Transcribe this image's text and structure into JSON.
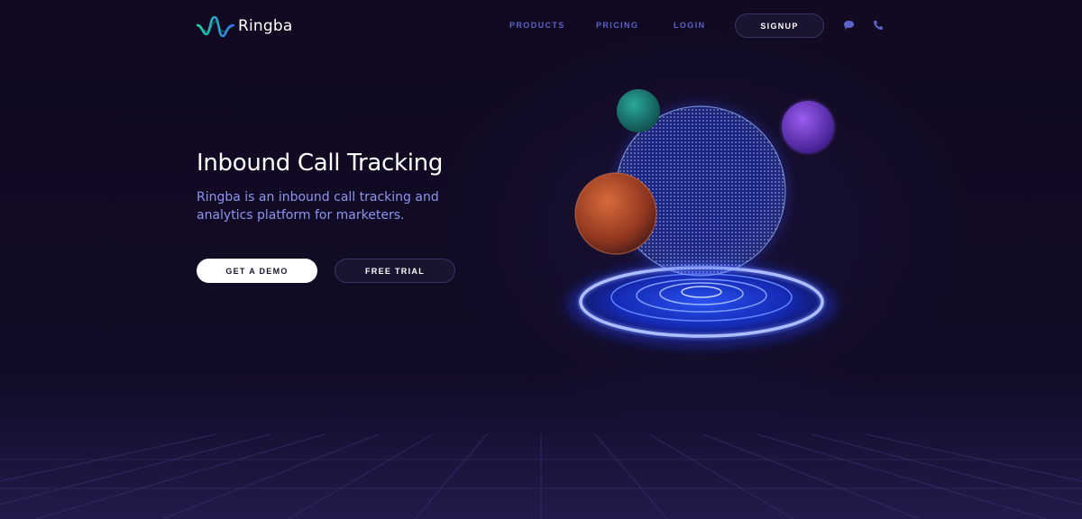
{
  "brand": {
    "name": "Ringba",
    "accent": "#5c63c9",
    "logo_gradient": [
      "#19d7a5",
      "#3a6cf0"
    ]
  },
  "nav": {
    "links": [
      {
        "label": "PRODUCTS"
      },
      {
        "label": "PRICING"
      },
      {
        "label": "LOGIN"
      }
    ],
    "signup_label": "SIGNUP",
    "icons": [
      "chat-bubble-icon",
      "phone-icon"
    ]
  },
  "hero": {
    "title": "Inbound Call Tracking",
    "subtitle": "Ringba is an inbound call tracking and analytics platform for marketers.",
    "primary_cta": "GET A DEMO",
    "secondary_cta": "FREE TRIAL"
  },
  "colors": {
    "background": "#120b24",
    "subtitle": "#8d95f0",
    "sphere_glow": "#2a4cff",
    "orb_orange": "#c4512a",
    "orb_teal": "#1c8f86",
    "orb_purple": "#7a3fd6"
  }
}
